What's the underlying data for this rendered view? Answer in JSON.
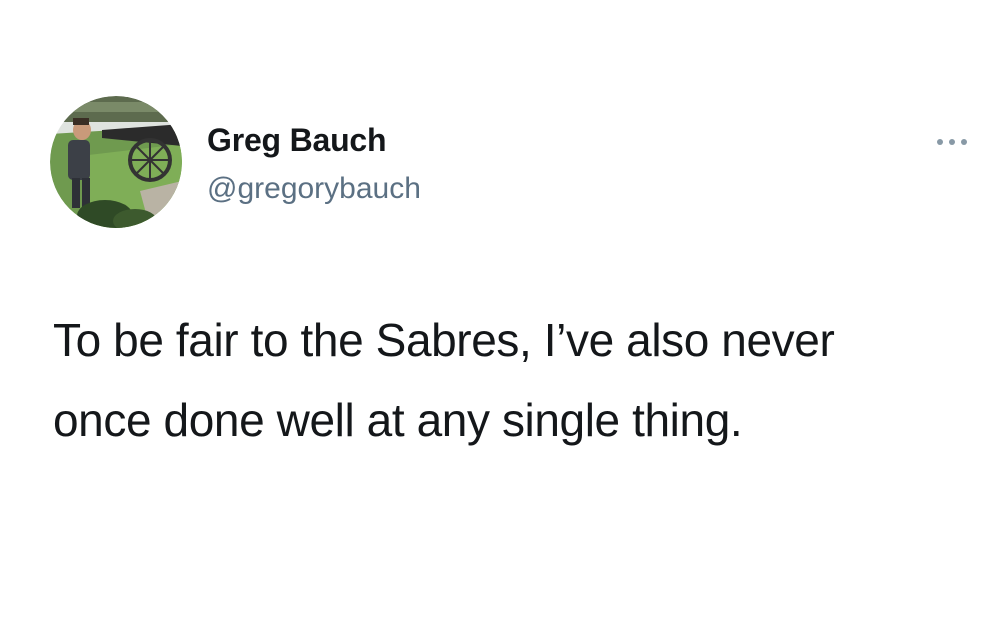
{
  "author": {
    "display_name": "Greg Bauch",
    "handle": "@gregorybauch"
  },
  "avatar": {
    "icon": "profile-photo"
  },
  "more_menu": {
    "icon": "more-horizontal-icon"
  },
  "tweet": {
    "lines": [
      "To be fair to the Sabres, I’ve also never",
      "once done well at any single thing."
    ]
  },
  "colors": {
    "text": "#14171a",
    "secondary": "#5b7083",
    "background": "#ffffff"
  }
}
